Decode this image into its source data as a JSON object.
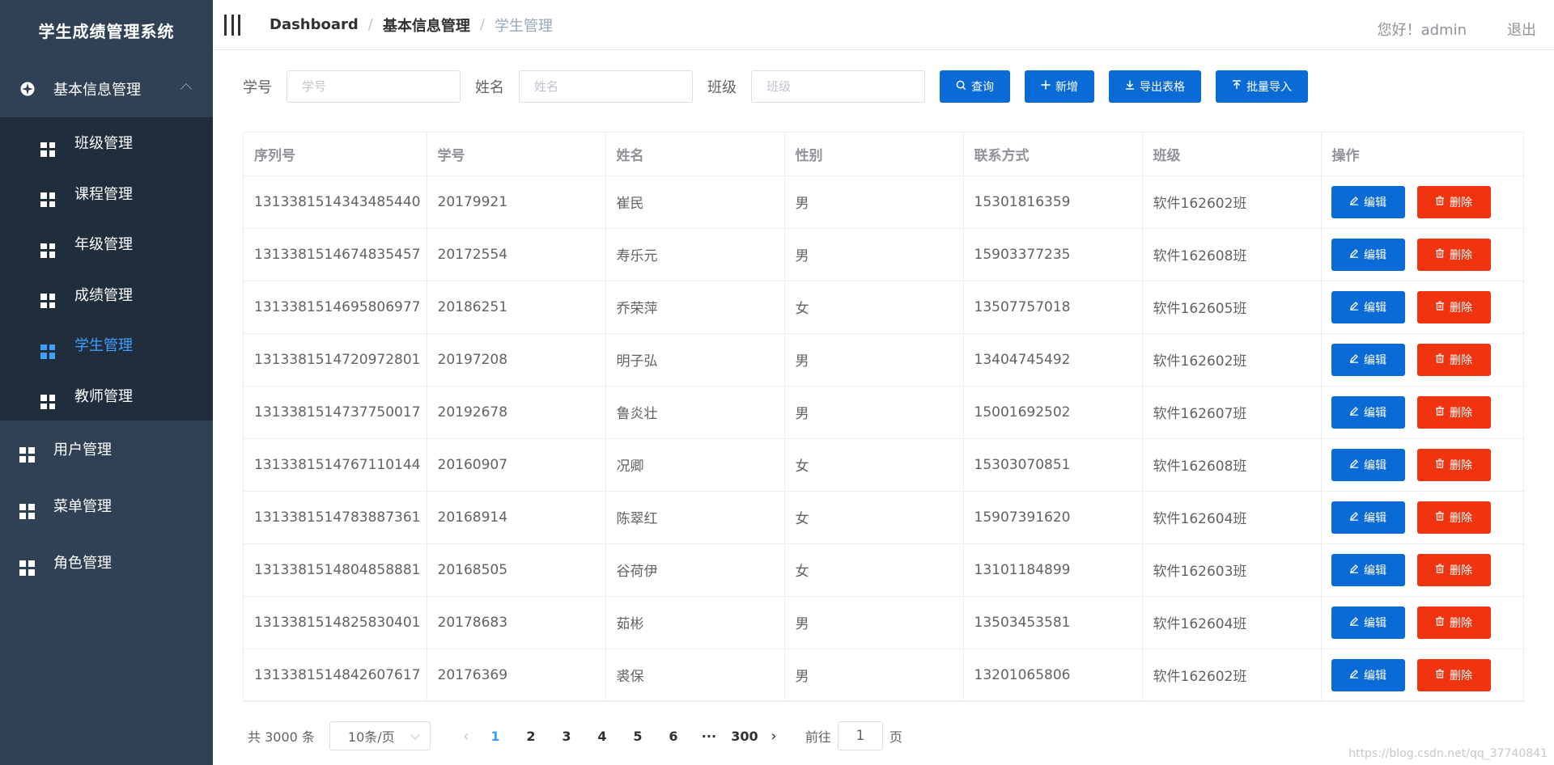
{
  "app": {
    "title": "学生成绩管理系统"
  },
  "colors": {
    "sidebar_bg": "#304156",
    "submenu_bg": "#1f2d3d",
    "accent": "#409eff",
    "primary_button": "#0a6bd6",
    "danger_button": "#f0340f"
  },
  "sidebar": {
    "group": {
      "label": "基本信息管理",
      "icon": "compass-icon"
    },
    "sub_items": [
      {
        "label": "班级管理",
        "active": false
      },
      {
        "label": "课程管理",
        "active": false
      },
      {
        "label": "年级管理",
        "active": false
      },
      {
        "label": "成绩管理",
        "active": false
      },
      {
        "label": "学生管理",
        "active": true
      },
      {
        "label": "教师管理",
        "active": false
      }
    ],
    "items": [
      {
        "label": "用户管理"
      },
      {
        "label": "菜单管理"
      },
      {
        "label": "角色管理"
      }
    ]
  },
  "header": {
    "breadcrumb": [
      "Dashboard",
      "基本信息管理",
      "学生管理"
    ],
    "separator": "/",
    "greeting": "您好！admin",
    "logout": "退出"
  },
  "search": {
    "fields": [
      {
        "label": "学号",
        "placeholder": "学号",
        "value": ""
      },
      {
        "label": "姓名",
        "placeholder": "姓名",
        "value": ""
      },
      {
        "label": "班级",
        "placeholder": "班级",
        "value": ""
      }
    ],
    "buttons": [
      {
        "label": "查询",
        "icon": "search-icon"
      },
      {
        "label": "新增",
        "icon": "plus-icon"
      },
      {
        "label": "导出表格",
        "icon": "download-icon"
      },
      {
        "label": "批量导入",
        "icon": "upload-icon"
      }
    ]
  },
  "table": {
    "columns": [
      "序列号",
      "学号",
      "姓名",
      "性别",
      "联系方式",
      "班级",
      "操作"
    ],
    "edit_label": "编辑",
    "delete_label": "删除",
    "rows": [
      [
        "1313381514343485440",
        "20179921",
        "崔民",
        "男",
        "15301816359",
        "软件162602班"
      ],
      [
        "1313381514674835457",
        "20172554",
        "寿乐元",
        "男",
        "15903377235",
        "软件162608班"
      ],
      [
        "1313381514695806977",
        "20186251",
        "乔荣萍",
        "女",
        "13507757018",
        "软件162605班"
      ],
      [
        "1313381514720972801",
        "20197208",
        "明子弘",
        "男",
        "13404745492",
        "软件162602班"
      ],
      [
        "1313381514737750017",
        "20192678",
        "鲁炎壮",
        "男",
        "15001692502",
        "软件162607班"
      ],
      [
        "1313381514767110144",
        "20160907",
        "况卿",
        "女",
        "15303070851",
        "软件162608班"
      ],
      [
        "1313381514783887361",
        "20168914",
        "陈翠红",
        "女",
        "15907391620",
        "软件162604班"
      ],
      [
        "1313381514804858881",
        "20168505",
        "谷荷伊",
        "女",
        "13101184899",
        "软件162603班"
      ],
      [
        "1313381514825830401",
        "20178683",
        "茹彬",
        "男",
        "13503453581",
        "软件162604班"
      ],
      [
        "1313381514842607617",
        "20176369",
        "裘保",
        "男",
        "13201065806",
        "软件162602班"
      ]
    ]
  },
  "pagination": {
    "total": "共 3000 条",
    "page_size": "10条/页",
    "pages": [
      "1",
      "2",
      "3",
      "4",
      "5",
      "6"
    ],
    "current_page": "1",
    "ellipsis": "···",
    "last_page": "300",
    "goto_label": "前往",
    "goto_value": "1",
    "goto_suffix": "页"
  },
  "watermark": "https://blog.csdn.net/qq_37740841"
}
